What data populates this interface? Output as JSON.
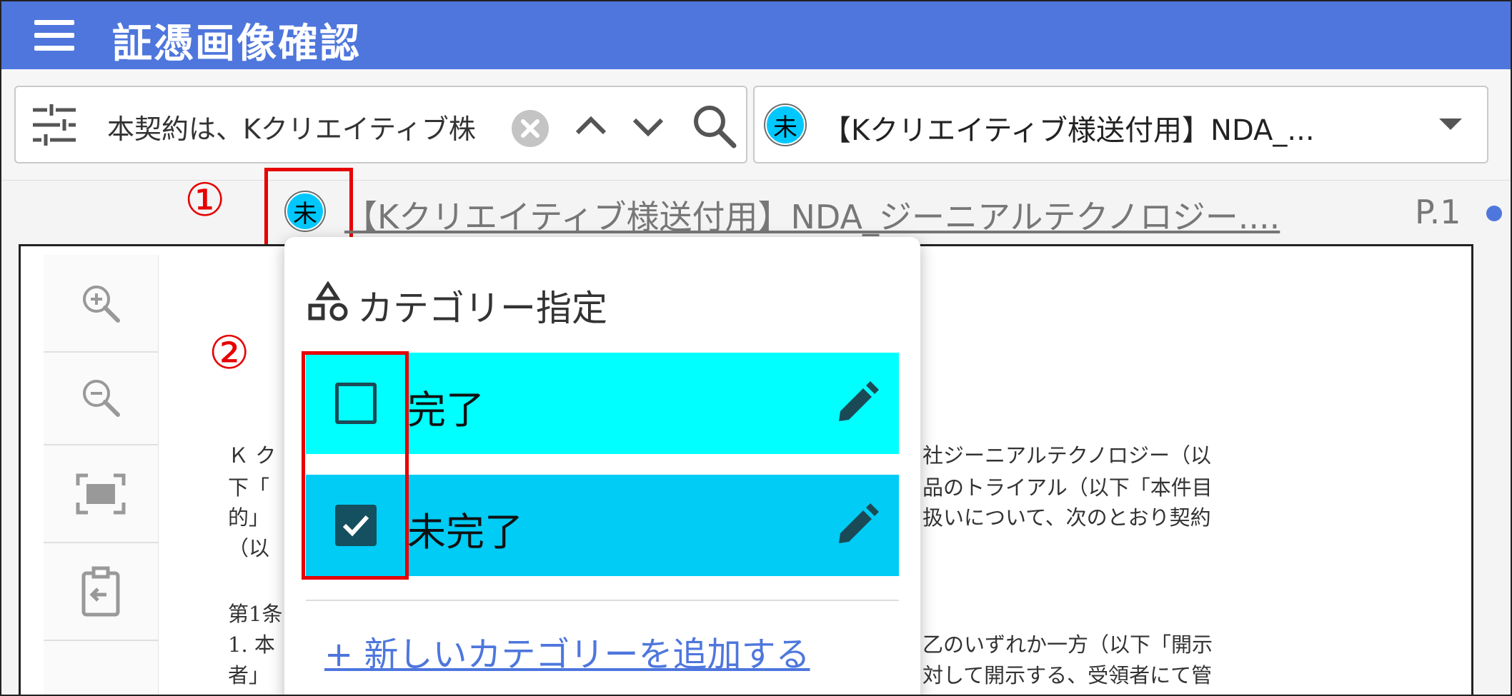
{
  "app": {
    "title": "証憑画像確認"
  },
  "search": {
    "value": "本契約は、Kクリエイティブ株"
  },
  "document_select": {
    "badge": "未",
    "value": "【Kクリエイティブ様送付用】NDA_..."
  },
  "document_heading": {
    "badge": "未",
    "title": "【Kクリエイティブ様送付用】NDA_ジーニアルテクノロジー....",
    "page": "P.1"
  },
  "annotations": {
    "one": "①",
    "two": "②"
  },
  "category_popup": {
    "title": "カテゴリー指定",
    "items": [
      {
        "label": "完了",
        "checked": false
      },
      {
        "label": "未完了",
        "checked": true
      }
    ],
    "add_link": "+ 新しいカテゴリーを追加する"
  },
  "document_body": {
    "left_fragments": [
      "Ｋ ク",
      "下「",
      "的」",
      "（以",
      "第1条",
      "1. 本",
      "者」"
    ],
    "right_lines": [
      "社ジーニアルテクノロジー（以",
      "品のトライアル（以下「本件目",
      "扱いについて、次のとおり契約",
      "乙のいずれか一方（以下「開示",
      "対して開示する、受領者にて管"
    ]
  },
  "colors": {
    "appbar": "#4e76dd",
    "badge": "#00c8ff",
    "row_done": "#00ffff",
    "row_pending": "#00ccf5",
    "annotation": "#e60000"
  },
  "icons": [
    "menu-icon",
    "filter-icon",
    "clear-icon",
    "chevron-up-icon",
    "chevron-down-icon",
    "search-icon",
    "dropdown-arrow-icon",
    "zoom-in-icon",
    "zoom-out-icon",
    "fit-screen-icon",
    "clipboard-icon",
    "category-shapes-icon",
    "pencil-icon"
  ]
}
